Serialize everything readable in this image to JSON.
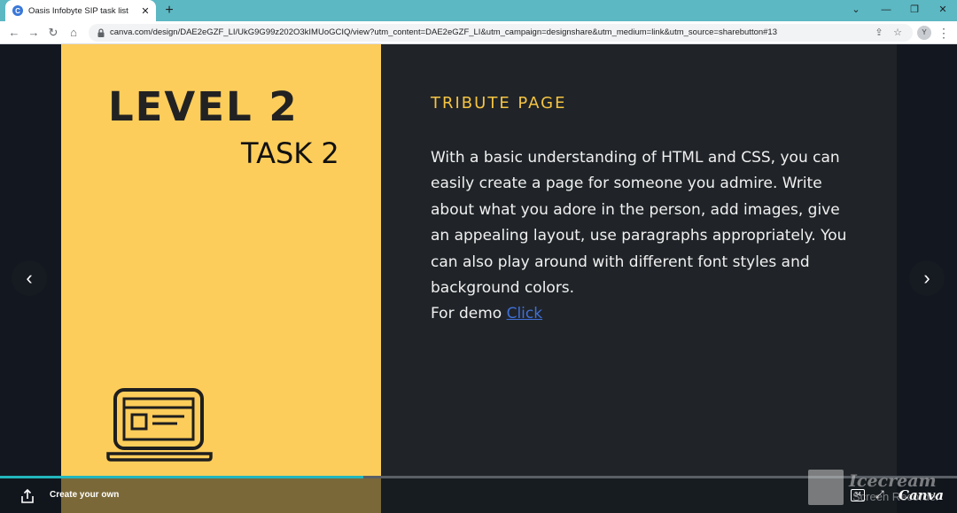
{
  "browser": {
    "tab_title": "Oasis Infobyte SIP task list",
    "tab_favicon_letter": "C",
    "close_glyph": "✕",
    "new_tab_glyph": "+",
    "url": "canva.com/design/DAE2eGZF_LI/UkG9G99z202O3kIMUoGCIQ/view?utm_content=DAE2eGZF_LI&utm_campaign=designshare&utm_medium=link&utm_source=sharebutton#13",
    "profile_initial": "Y"
  },
  "slide": {
    "level_title": "LEVEL 2",
    "task_title": "TASK 2",
    "heading": "TRIBUTE PAGE",
    "body": "With a basic understanding of HTML and CSS, you can easily create a page for someone you admire. Write about what you adore in the person, add images, give an appealing layout, use paragraphs appropriately. You can also play around with different font styles and background colors.",
    "demo_prefix": "For demo",
    "demo_link": "Click"
  },
  "viewer": {
    "prev_glyph": "‹",
    "next_glyph": "›",
    "create_own_label": "Create your own",
    "page_number": "34",
    "logo": "Canva",
    "progress_percent": 38
  },
  "watermark": {
    "title": "Icecream",
    "subtitle": "Screen Recorder"
  },
  "colors": {
    "tabbar": "#5cb8c3",
    "slide_yellow": "#fdcd5b",
    "slide_dark": "#202428",
    "heading_gold": "#f5c443",
    "link_blue": "#3f6fd6",
    "progress_teal": "#22b6bd"
  },
  "icons": [
    "canva-favicon-icon",
    "back-arrow-icon",
    "forward-arrow-icon",
    "reload-icon",
    "home-icon",
    "lock-icon",
    "share-page-icon",
    "bookmark-star-icon",
    "laptop-icon",
    "prev-slide-icon",
    "next-slide-icon",
    "share-icon",
    "fullscreen-icon"
  ]
}
